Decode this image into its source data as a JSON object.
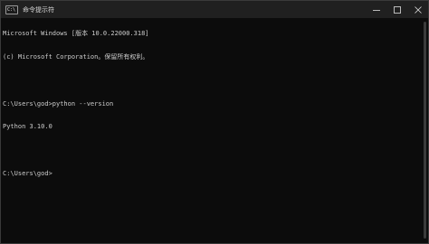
{
  "window": {
    "title": "命令提示符",
    "icon_glyph": "C:\\",
    "icon_name": "terminal-icon"
  },
  "console": {
    "lines": [
      "Microsoft Windows [版本 10.0.22000.318]",
      "(c) Microsoft Corporation。保留所有权利。",
      "",
      "C:\\Users\\god>python --version",
      "Python 3.10.0",
      "",
      "C:\\Users\\god>"
    ]
  },
  "colors": {
    "background": "#0c0c0c",
    "titlebar": "#202020",
    "text": "#cccccc"
  }
}
